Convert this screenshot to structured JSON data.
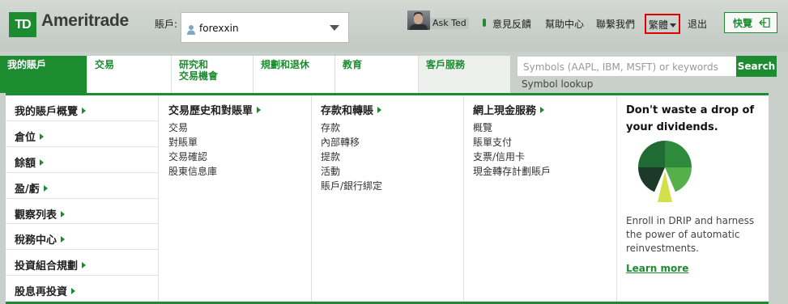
{
  "header": {
    "logo_mark": "TD",
    "logo_text": "Ameritrade",
    "account_label": "賬戶:",
    "account_value": "forexxin",
    "ask_ted": "Ask Ted",
    "links": [
      "意見反饋",
      "幫助中心",
      "聯繫我們"
    ],
    "language": "繁體",
    "logout": "退出",
    "quick_view": "快覽"
  },
  "nav": {
    "tabs": [
      "我的賬戶",
      "交易",
      "研究和\n交易機會",
      "規劃和退休",
      "教育",
      "客戶服務"
    ]
  },
  "search": {
    "placeholder": "Symbols (AAPL, IBM, MSFT) or keywords",
    "button": "Search",
    "lookup": "Symbol lookup"
  },
  "menu": {
    "left_items": [
      "我的賬戶概覽",
      "倉位",
      "餘額",
      "盈/虧",
      "觀察列表",
      "稅務中心",
      "投資組合規劃",
      "股息再投資"
    ],
    "columns": [
      {
        "title": "交易歷史和對賬單",
        "links": [
          "交易",
          "對賬單",
          "交易確認",
          "股東信息庫"
        ]
      },
      {
        "title": "存款和轉賬",
        "links": [
          "存款",
          "內部轉移",
          "提款",
          "活動",
          "賬戶/銀行綁定"
        ]
      },
      {
        "title": "網上現金服務",
        "links": [
          "概覽",
          "賬單支付",
          "支票/信用卡",
          "現金轉存計劃賬戶"
        ]
      }
    ],
    "promo": {
      "title": "Don't waste a drop of your dividends.",
      "body": "Enroll in DRIP and harness the power of automatic reinvestments.",
      "link": "Learn more"
    }
  },
  "colors": {
    "brand_green": "#1d8c31",
    "header_bg": "#c9cfca",
    "highlight_red": "#e00000"
  },
  "icons": [
    "user-icon",
    "avatar",
    "feedback-icon",
    "chevron-down-icon",
    "exit-icon",
    "arrow-right-icon",
    "pie-chart-icon"
  ]
}
